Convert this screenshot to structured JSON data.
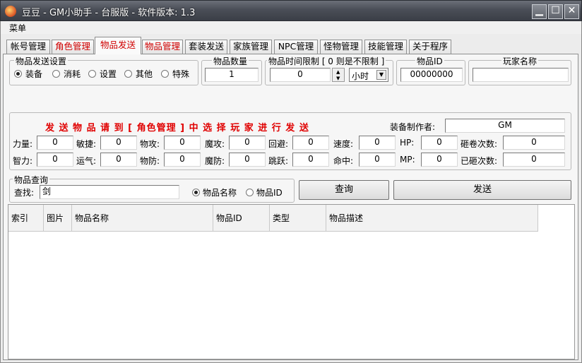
{
  "window": {
    "title": "豆豆 - GM小助手 - 台服版 - 软件版本: 1.3",
    "min": "▁",
    "max": "☐",
    "close": "✕"
  },
  "menu": {
    "label": "菜单"
  },
  "tabs": [
    "帐号管理",
    "角色管理",
    "物品发送",
    "物品管理",
    "套装发送",
    "家族管理",
    "NPC管理",
    "怪物管理",
    "技能管理",
    "关于程序"
  ],
  "send_settings": {
    "title": "物品发送设置",
    "options": [
      "装备",
      "消耗",
      "设置",
      "其他",
      "特殊"
    ],
    "selected": "装备"
  },
  "quantity": {
    "title": "物品数量",
    "value": "1"
  },
  "time_limit": {
    "title": "物品时间限制 [ 0 则是不限制 ]",
    "value": "0",
    "unit": "小时"
  },
  "item_id": {
    "title": "物品ID",
    "value": "00000000"
  },
  "player_name": {
    "title": "玩家名称",
    "value": ""
  },
  "attributes": {
    "hint": "发 送 物 品 请 到 [ 角色管理 ] 中 选 择 玩 家 进 行 发 送",
    "maker_label": "装备制作者:",
    "maker_value": "GM",
    "row1": [
      {
        "label": "力量:",
        "value": "0"
      },
      {
        "label": "敏捷:",
        "value": "0"
      },
      {
        "label": "物攻:",
        "value": "0"
      },
      {
        "label": "魔攻:",
        "value": "0"
      },
      {
        "label": "回避:",
        "value": "0"
      },
      {
        "label": "速度:",
        "value": "0"
      },
      {
        "label": "HP:",
        "value": "0"
      },
      {
        "label": "砸卷次数:",
        "value": "0"
      }
    ],
    "row2": [
      {
        "label": "智力:",
        "value": "0"
      },
      {
        "label": "运气:",
        "value": "0"
      },
      {
        "label": "物防:",
        "value": "0"
      },
      {
        "label": "魔防:",
        "value": "0"
      },
      {
        "label": "跳跃:",
        "value": "0"
      },
      {
        "label": "命中:",
        "value": "0"
      },
      {
        "label": "MP:",
        "value": "0"
      },
      {
        "label": "已砸次数:",
        "value": "0"
      }
    ]
  },
  "query": {
    "title": "物品查询",
    "search_label": "查找:",
    "search_value": "剑",
    "radio_name": "物品名称",
    "radio_id": "物品ID",
    "selected": "物品名称",
    "query_button": "查询",
    "send_button": "发送"
  },
  "table": {
    "columns": [
      "索引",
      "图片",
      "物品名称",
      "物品ID",
      "类型",
      "物品描述"
    ]
  }
}
